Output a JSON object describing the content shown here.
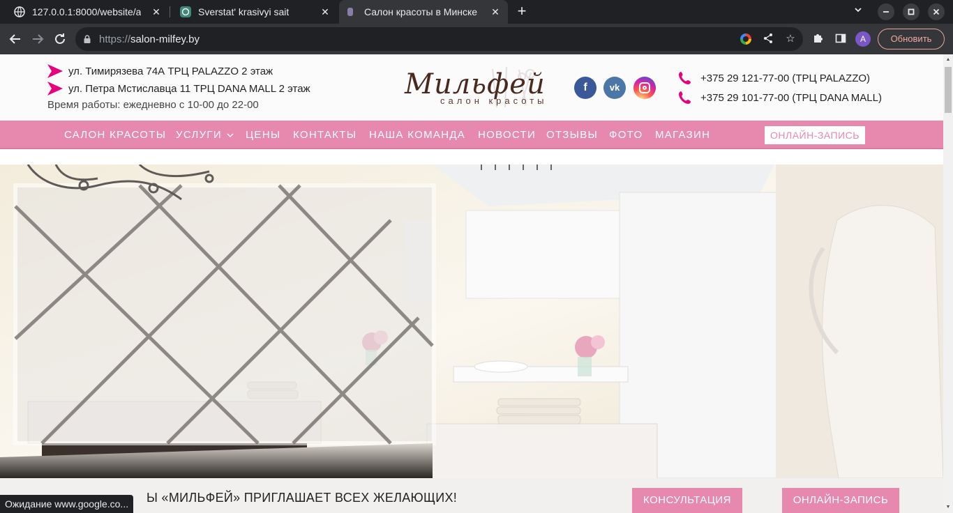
{
  "browser": {
    "tabs": [
      {
        "title": "127.0.0.1:8000/website/a"
      },
      {
        "title": "Sverstat' krasivyi sait"
      },
      {
        "title": "Салон красоты в Минске"
      }
    ],
    "url_scheme": "https://",
    "url_host": "salon-milfey.by",
    "avatar_letter": "A",
    "update_button": "Обновить",
    "status_text": "Ожидание www.google.co..."
  },
  "header": {
    "addresses": [
      "ул. Тимирязева 74А ТРЦ PALAZZO 2 этаж",
      "ул. Петра Мстиславца 11 ТРЦ DANA MALL 2 этаж"
    ],
    "hours": "Время работы: ежедневно с 10-00 до 22-00",
    "logo_script": "Мильфей",
    "logo_sub": "салон красоты",
    "phones": [
      "+375 29 121-77-00 (ТРЦ PALAZZO)",
      "+375 29 101-77-00 (ТРЦ DANA MALL)"
    ],
    "social": [
      {
        "name": "facebook",
        "glyph": "f",
        "color": "#3b5998"
      },
      {
        "name": "vk",
        "glyph": "vk",
        "color": "#4a76a8"
      },
      {
        "name": "instagram",
        "glyph": "",
        "color": "#d6249f"
      }
    ]
  },
  "nav": {
    "items": [
      "САЛОН КРАСОТЫ",
      "УСЛУГИ",
      "ЦЕНЫ",
      "КОНТАКТЫ",
      "НАША КОМАНДА",
      "НОВОСТИ",
      "ОТЗЫВЫ",
      "ФОТО",
      "МАГАЗИН"
    ],
    "cta": "ОНЛАЙН-ЗАПИСЬ"
  },
  "strip": {
    "text": "Ы «МИЛЬФЕЙ» ПРИГЛАШАЕТ ВСЕХ ЖЕЛАЮЩИХ!",
    "consult_button": "КОНСУЛЬТАЦИЯ",
    "booking_button": "ОНЛАЙН-ЗАПИСЬ"
  },
  "colors": {
    "brand_pink": "#e789ae",
    "accent_magenta": "#e6007e",
    "logo_brown": "#4a2a20"
  }
}
